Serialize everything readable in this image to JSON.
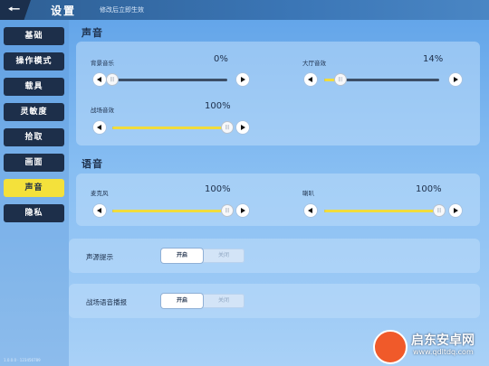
{
  "header": {
    "title": "设置",
    "back_icon": "arrow-left-icon",
    "hint": "修改后立即生效"
  },
  "sidebar": {
    "items": [
      {
        "label": "基础",
        "active": false
      },
      {
        "label": "操作模式",
        "active": false
      },
      {
        "label": "载具",
        "active": false
      },
      {
        "label": "灵敏度",
        "active": false
      },
      {
        "label": "拾取",
        "active": false
      },
      {
        "label": "画面",
        "active": false
      },
      {
        "label": "声音",
        "active": true
      },
      {
        "label": "隐私",
        "active": false
      }
    ],
    "version": "1.0.0.0 · 123456789"
  },
  "sound": {
    "title": "声音",
    "sliders": [
      {
        "label": "背景音乐",
        "value": "0%",
        "level": 0
      },
      {
        "label": "大厅音效",
        "value": "14%",
        "level": 0.14
      },
      {
        "label": "战场音效",
        "value": "100%",
        "level": 1
      }
    ]
  },
  "voice": {
    "title": "语音",
    "sliders": [
      {
        "label": "麦克风",
        "value": "100%",
        "level": 1
      },
      {
        "label": "喇叭",
        "value": "100%",
        "level": 1
      }
    ]
  },
  "toggles": [
    {
      "label": "声源提示",
      "on_label": "开启",
      "off_label": "关闭",
      "selected": "开启"
    },
    {
      "label": "战场语音播报",
      "on_label": "开启",
      "off_label": "关闭",
      "selected": "开启"
    }
  ],
  "watermark": {
    "name": "启东安卓网",
    "url": "www.qdltdq.com"
  },
  "colors": {
    "accent": "#f4e13b",
    "dark": "#1d2f4a",
    "track": "#3c4e66"
  }
}
